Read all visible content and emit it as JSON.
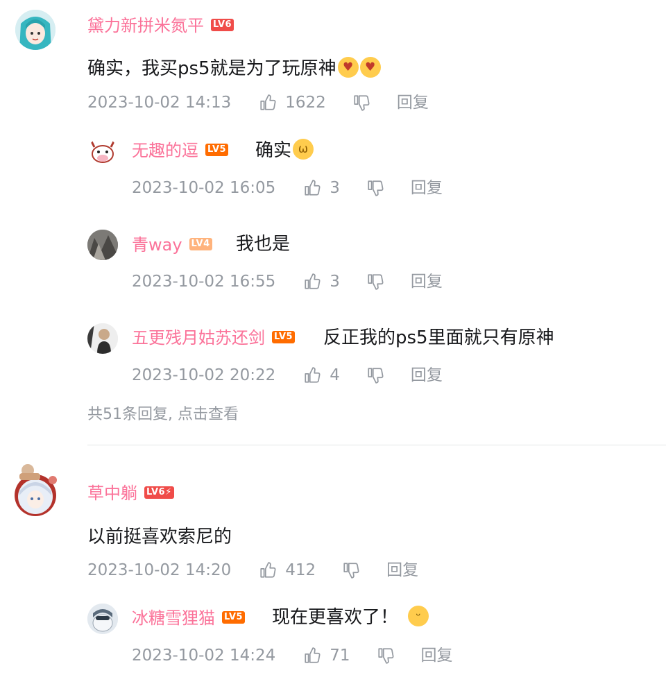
{
  "comments": [
    {
      "user": "黛力新拼米氮平",
      "level": "LV6",
      "text": "确实，我买ps5就是为了玩原神",
      "time": "2023-10-02 14:13",
      "likes": "1622",
      "reply_label": "回复",
      "replies": [
        {
          "user": "无趣的逗",
          "level": "LV5",
          "text": "确实",
          "time": "2023-10-02 16:05",
          "likes": "3",
          "reply_label": "回复"
        },
        {
          "user": "青way",
          "level": "LV4",
          "text": "我也是",
          "time": "2023-10-02 16:55",
          "likes": "3",
          "reply_label": "回复"
        },
        {
          "user": "五更残月姑苏还剑",
          "level": "LV5",
          "text": "反正我的ps5里面就只有原神",
          "time": "2023-10-02 20:22",
          "likes": "4",
          "reply_label": "回复"
        }
      ],
      "more_replies": "共51条回复, 点击查看"
    },
    {
      "user": "草中躺",
      "level": "LV6",
      "text": "以前挺喜欢索尼的",
      "time": "2023-10-02 14:20",
      "likes": "412",
      "reply_label": "回复",
      "replies": [
        {
          "user": "冰糖雪狸猫",
          "level": "LV5",
          "text": "现在更喜欢了！",
          "time": "2023-10-02 14:24",
          "likes": "71",
          "reply_label": "回复"
        }
      ]
    }
  ],
  "colors": {
    "username": "#fb7299",
    "meta": "#9499a0",
    "text": "#18191c",
    "lv6": "#f04c49",
    "lv5": "#ff6c00",
    "lv4": "#ffb37c"
  },
  "icons": {
    "like": "thumbs-up-icon",
    "dislike": "thumbs-down-icon",
    "emoji_heart_eyes": "heart-eyes-emoji",
    "emoji_cat": "cat-emoji",
    "emoji_grin": "grin-emoji"
  }
}
